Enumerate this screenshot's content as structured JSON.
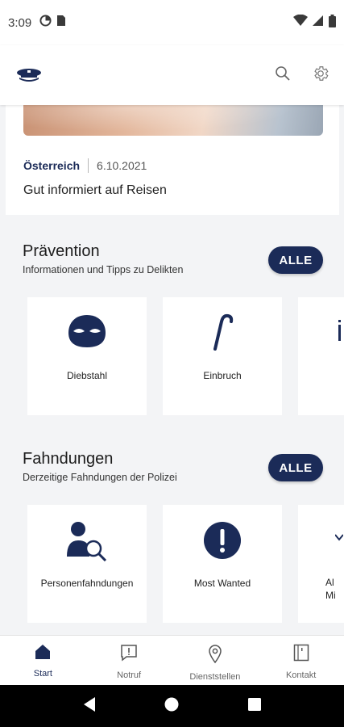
{
  "status_bar": {
    "time": "3:09"
  },
  "news": {
    "country": "Österreich",
    "date": "6.10.2021",
    "headline": "Gut informiert auf Reisen"
  },
  "praevention": {
    "title": "Prävention",
    "subtitle": "Informationen und Tipps zu Delikten",
    "all_label": "ALLE",
    "items": [
      {
        "label": "Diebstahl",
        "icon": "mask-icon"
      },
      {
        "label": "Einbruch",
        "icon": "crowbar-icon"
      }
    ]
  },
  "fahndungen": {
    "title": "Fahndungen",
    "subtitle": "Derzeitige Fahndungen der Polizei",
    "all_label": "ALLE",
    "items": [
      {
        "label": "Personenfahndungen",
        "icon": "person-search-icon"
      },
      {
        "label": "Most Wanted",
        "icon": "exclamation-icon"
      },
      {
        "label": "Al\nMi",
        "icon": "partial-icon"
      }
    ]
  },
  "bottom_nav": {
    "items": [
      {
        "label": "Start",
        "icon": "home-icon",
        "active": true
      },
      {
        "label": "Notruf",
        "icon": "emergency-icon",
        "active": false
      },
      {
        "label": "Dienststellen",
        "icon": "location-pin-icon",
        "active": false
      },
      {
        "label": "Kontakt",
        "icon": "contact-book-icon",
        "active": false
      }
    ]
  },
  "colors": {
    "brand_navy": "#1b2b58",
    "background": "#f3f4f6"
  }
}
